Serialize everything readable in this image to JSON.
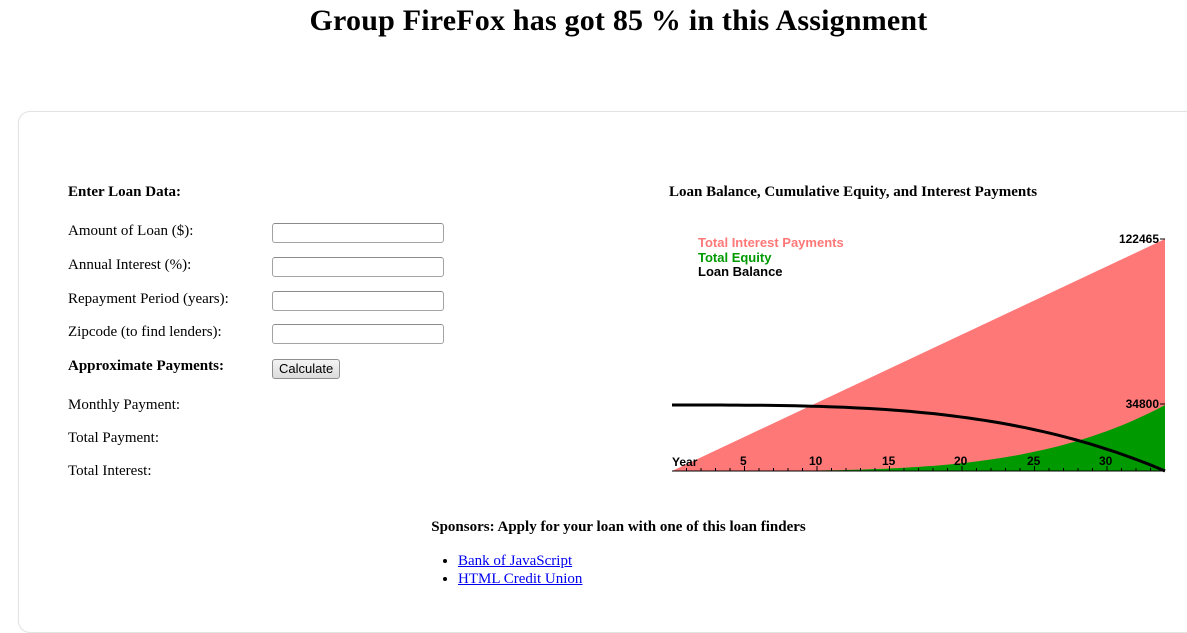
{
  "page": {
    "title": "Group FireFox has got 85 % in this Assignment"
  },
  "form": {
    "heading": "Enter Loan Data:",
    "fields": [
      {
        "label": "Amount of Loan ($):",
        "value": ""
      },
      {
        "label": "Annual Interest (%):",
        "value": ""
      },
      {
        "label": "Repayment Period (years):",
        "value": ""
      },
      {
        "label": "Zipcode (to find lenders):",
        "value": ""
      }
    ],
    "payments_label": "Approximate Payments:",
    "calculate_label": "Calculate",
    "results": [
      {
        "label": "Monthly Payment:",
        "value": ""
      },
      {
        "label": "Total Payment:",
        "value": ""
      },
      {
        "label": "Total Interest:",
        "value": ""
      }
    ]
  },
  "chart_title": "Loan Balance, Cumulative Equity, and Interest Payments",
  "chart_data": {
    "type": "area",
    "title": "Loan Balance, Cumulative Equity, and Interest Payments",
    "x_label": "Year",
    "x_ticks": [
      5,
      10,
      15,
      20,
      25,
      30
    ],
    "x_range": [
      0,
      34
    ],
    "y_range": [
      0,
      122465
    ],
    "series": [
      {
        "name": "Total Interest Payments",
        "color": "#ff7878",
        "end_value": 122465
      },
      {
        "name": "Total Equity",
        "color": "#009a00",
        "end_value": 34800
      },
      {
        "name": "Loan Balance",
        "color": "#000000"
      }
    ],
    "annotations": [
      "122465",
      "34800"
    ],
    "legend": "top-left"
  },
  "sponsors": {
    "heading": "Sponsors: Apply for your loan with one of this loan finders",
    "links": [
      "Bank of JavaScript",
      "HTML Credit Union"
    ]
  }
}
